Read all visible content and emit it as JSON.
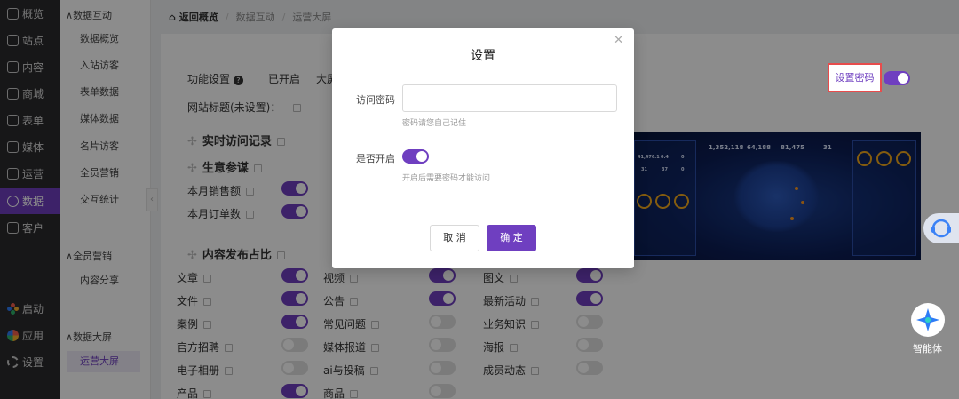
{
  "nav": {
    "items": [
      {
        "label": "概览",
        "icon": "overview-icon"
      },
      {
        "label": "站点",
        "icon": "site-icon"
      },
      {
        "label": "内容",
        "icon": "content-icon"
      },
      {
        "label": "商城",
        "icon": "mall-icon"
      },
      {
        "label": "表单",
        "icon": "form-icon"
      },
      {
        "label": "媒体",
        "icon": "media-icon"
      },
      {
        "label": "运营",
        "icon": "operation-icon"
      },
      {
        "label": "数据",
        "icon": "data-icon",
        "active": true
      },
      {
        "label": "客户",
        "icon": "customer-icon"
      }
    ],
    "bottom": [
      {
        "label": "启动",
        "icon": "launch-icon"
      },
      {
        "label": "应用",
        "icon": "apps-icon"
      },
      {
        "label": "设置",
        "icon": "settings-icon"
      }
    ]
  },
  "subnav": {
    "group1": {
      "title": "数据互动",
      "items": [
        "数据概览",
        "入站访客",
        "表单数据",
        "媒体数据",
        "名片访客",
        "全员营销",
        "交互统计"
      ]
    },
    "group2": {
      "title": "全员营销",
      "items": [
        "内容分享"
      ]
    },
    "group3": {
      "title": "数据大屏",
      "items": [
        "运营大屏"
      ]
    },
    "collapse_icon": "chevron-left-icon"
  },
  "breadcrumb": {
    "home": "返回概览",
    "sep": "/",
    "items": [
      "数据互动",
      "运营大屏"
    ]
  },
  "content": {
    "feature_label": "功能设置",
    "enabled_label": "已开启",
    "bigscreen_label": "大屏",
    "site_title_label": "网站标题(未设置)：",
    "section_realtime": "实时访问记录",
    "section_business": "生意参谋",
    "rows_business": [
      {
        "label": "本月销售额",
        "on": true
      },
      {
        "label": "本月订单数",
        "on": true
      }
    ],
    "section_content": "内容发布占比",
    "grid": [
      [
        {
          "label": "文章",
          "on": true
        },
        {
          "label": "视频",
          "on": true
        },
        {
          "label": "图文",
          "on": true
        }
      ],
      [
        {
          "label": "文件",
          "on": true
        },
        {
          "label": "公告",
          "on": true
        },
        {
          "label": "最新活动",
          "on": true
        }
      ],
      [
        {
          "label": "案例",
          "on": true
        },
        {
          "label": "常见问题",
          "on": false
        },
        {
          "label": "业务知识",
          "on": false
        }
      ],
      [
        {
          "label": "官方招聘",
          "on": false
        },
        {
          "label": "媒体报道",
          "on": false
        },
        {
          "label": "海报",
          "on": false
        }
      ],
      [
        {
          "label": "电子相册",
          "on": false
        },
        {
          "label": "ai与投稿",
          "on": false
        },
        {
          "label": "成员动态",
          "on": false
        }
      ],
      [
        {
          "label": "产品",
          "on": true
        },
        {
          "label": "商品",
          "on": false
        },
        {
          "label": "",
          "on": null
        }
      ]
    ],
    "set_password_label": "设置密码",
    "set_password_on": true,
    "preview": {
      "stats": [
        "1,352,118",
        "64,188",
        "81,475",
        "31"
      ],
      "side": [
        "41,476.1",
        "0.4",
        "0",
        "31",
        "37",
        "0"
      ]
    }
  },
  "modal": {
    "title": "设置",
    "close_icon": "close-icon",
    "password_label": "访问密码",
    "password_value": "",
    "password_placeholder": "",
    "password_hint": "密码请您自己记住",
    "enable_label": "是否开启",
    "enable_on": true,
    "enable_hint": "开启后需要密码才能访问",
    "cancel_label": "取 消",
    "ok_label": "确 定"
  },
  "widgets": {
    "support_icon": "customer-service-icon",
    "agent_icon": "smart-agent-icon",
    "agent_label": "智能体"
  },
  "colors": {
    "accent": "#6f3fc0",
    "nav_bg": "#2a2a2c",
    "highlight": "#e84c4c"
  }
}
